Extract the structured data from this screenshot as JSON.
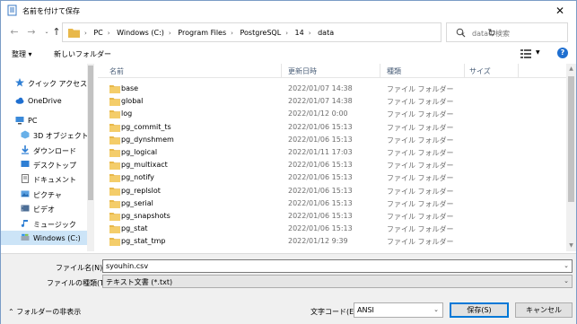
{
  "window": {
    "title": "名前を付けて保存",
    "close_glyph": "✕"
  },
  "address": {
    "crumbs": [
      "PC",
      "Windows (C:)",
      "Program Files",
      "PostgreSQL",
      "14",
      "data"
    ],
    "search_placeholder": "dataの検索"
  },
  "toolbar": {
    "organize_label": "整理 ▾",
    "new_folder_label": "新しいフォルダー",
    "help_glyph": "?"
  },
  "nav": {
    "items": [
      {
        "label": "クイック アクセス",
        "icon": "star-icon"
      },
      {
        "label": "OneDrive",
        "icon": "cloud-icon"
      },
      {
        "label": "PC",
        "icon": "computer-icon"
      },
      {
        "label": "3D オブジェクト",
        "icon": "cube-icon"
      },
      {
        "label": "ダウンロード",
        "icon": "download-icon"
      },
      {
        "label": "デスクトップ",
        "icon": "desktop-icon"
      },
      {
        "label": "ドキュメント",
        "icon": "document-icon"
      },
      {
        "label": "ピクチャ",
        "icon": "picture-icon"
      },
      {
        "label": "ビデオ",
        "icon": "video-icon"
      },
      {
        "label": "ミュージック",
        "icon": "music-icon"
      },
      {
        "label": "Windows (C:)",
        "icon": "drive-icon"
      }
    ]
  },
  "list": {
    "columns": {
      "name": "名前",
      "date": "更新日時",
      "type": "種類",
      "size": "サイズ"
    },
    "rows": [
      {
        "name": "base",
        "date": "2022/01/07 14:38",
        "type": "ファイル フォルダー"
      },
      {
        "name": "global",
        "date": "2022/01/07 14:38",
        "type": "ファイル フォルダー"
      },
      {
        "name": "log",
        "date": "2022/01/12 0:00",
        "type": "ファイル フォルダー"
      },
      {
        "name": "pg_commit_ts",
        "date": "2022/01/06 15:13",
        "type": "ファイル フォルダー"
      },
      {
        "name": "pg_dynshmem",
        "date": "2022/01/06 15:13",
        "type": "ファイル フォルダー"
      },
      {
        "name": "pg_logical",
        "date": "2022/01/11 17:03",
        "type": "ファイル フォルダー"
      },
      {
        "name": "pg_multixact",
        "date": "2022/01/06 15:13",
        "type": "ファイル フォルダー"
      },
      {
        "name": "pg_notify",
        "date": "2022/01/06 15:13",
        "type": "ファイル フォルダー"
      },
      {
        "name": "pg_replslot",
        "date": "2022/01/06 15:13",
        "type": "ファイル フォルダー"
      },
      {
        "name": "pg_serial",
        "date": "2022/01/06 15:13",
        "type": "ファイル フォルダー"
      },
      {
        "name": "pg_snapshots",
        "date": "2022/01/06 15:13",
        "type": "ファイル フォルダー"
      },
      {
        "name": "pg_stat",
        "date": "2022/01/06 15:13",
        "type": "ファイル フォルダー"
      },
      {
        "name": "pg_stat_tmp",
        "date": "2022/01/12 9:39",
        "type": "ファイル フォルダー"
      }
    ]
  },
  "form": {
    "filename_label": "ファイル名(N):",
    "filename_value": "syouhin.csv",
    "filetype_label": "ファイルの種類(T):",
    "filetype_value": "テキスト文書 (*.txt)",
    "hide_folders_label": "フォルダーの非表示",
    "encoding_label": "文字コード(E):",
    "encoding_value": "ANSI",
    "save_label": "保存(S)",
    "cancel_label": "キャンセル"
  },
  "colors": {
    "selection": "#cce4f7",
    "folder": "#e8b84a",
    "accent": "#0078d7"
  }
}
